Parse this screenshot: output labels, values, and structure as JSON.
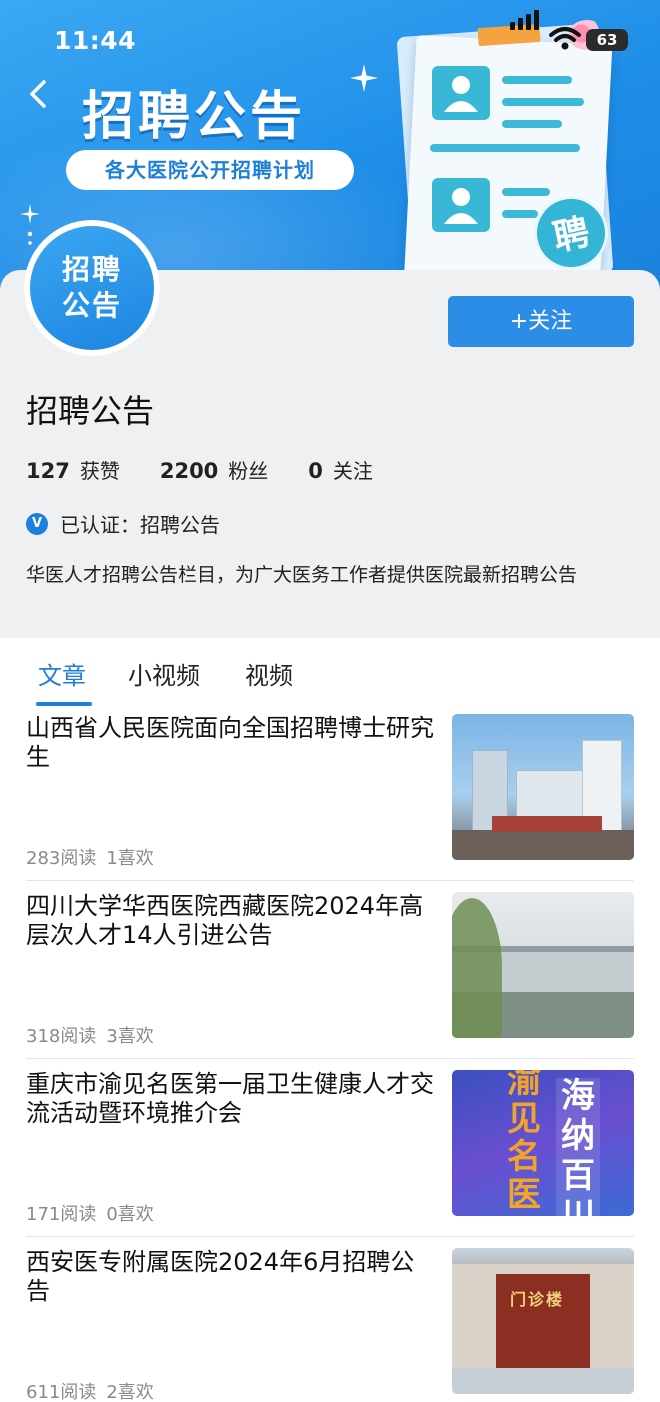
{
  "status_bar": {
    "time": "11:44",
    "battery": "63"
  },
  "banner": {
    "title": "招聘公告",
    "subtitle": "各大医院公开招聘计划",
    "badge": "聘"
  },
  "profile": {
    "avatar_line1": "招聘",
    "avatar_line2": "公告",
    "follow_label": "+关注",
    "name": "招聘公告",
    "stats": [
      {
        "value": "127",
        "label": "获赞"
      },
      {
        "value": "2200",
        "label": "粉丝"
      },
      {
        "value": "0",
        "label": "关注"
      }
    ],
    "verify_mark": "V",
    "verified": "已认证：招聘公告",
    "bio": "华医人才招聘公告栏目，为广大医务工作者提供医院最新招聘公告"
  },
  "tabs": [
    {
      "label": "文章",
      "active": true
    },
    {
      "label": "小视频",
      "active": false
    },
    {
      "label": "视频",
      "active": false
    }
  ],
  "articles": [
    {
      "title": "山西省人民医院面向全国招聘博士研究生",
      "reads": "283阅读",
      "likes": "1喜欢"
    },
    {
      "title": "四川大学华西医院西藏医院2024年高层次人才14人引进公告",
      "reads": "318阅读",
      "likes": "3喜欢"
    },
    {
      "title": "重庆市渝见名医第一届卫生健康人才交流活动暨环境推介会",
      "reads": "171阅读",
      "likes": "0喜欢",
      "thumb_text": [
        "渝",
        "见",
        "名",
        "医",
        "海",
        "纳",
        "百",
        "川"
      ]
    },
    {
      "title": "西安医专附属医院2024年6月招聘公告",
      "reads": "611阅读",
      "likes": "2喜欢",
      "thumb_text": [
        "门诊楼"
      ]
    }
  ],
  "colors": {
    "accent": "#1e7ee0",
    "banner": "#2594ea",
    "follow_button": "#2b8de6"
  },
  "icons": {
    "back": "chevron-left-icon",
    "verify": "verified-badge-icon"
  }
}
